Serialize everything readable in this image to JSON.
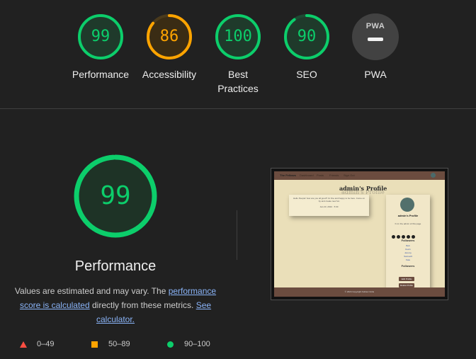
{
  "categories": [
    {
      "score": "99",
      "label": "Performance",
      "color": "#0cce6b"
    },
    {
      "score": "86",
      "label": "Accessibility",
      "color": "#ffa400"
    },
    {
      "score": "100",
      "label": "Best Practices",
      "color": "#0cce6b"
    },
    {
      "score": "90",
      "label": "SEO",
      "color": "#0cce6b"
    },
    {
      "score": "",
      "label": "PWA",
      "badge": "PWA"
    }
  ],
  "main": {
    "score": "99",
    "title": "Performance",
    "desc_prefix": "Values are estimated and may vary. The ",
    "desc_link1": "performance score is calculated",
    "desc_middle": " directly from these metrics. ",
    "desc_link2": "See calculator."
  },
  "legend": [
    {
      "icon": "red-triangle-icon",
      "range": "0–49",
      "color": "#ff4e42"
    },
    {
      "icon": "orange-square-icon",
      "range": "50–89",
      "color": "#ffa400"
    },
    {
      "icon": "green-circle-icon",
      "range": "90–100",
      "color": "#0cce6b"
    }
  ],
  "screenshot": {
    "brand": "The Fellows",
    "nav": [
      "Dashboard",
      "Posts",
      "Friends",
      "Sign Out"
    ],
    "title": "admin's Profile",
    "post_text": "Hello People! how are you all good? Im fine and happy to be here. Come on by and create new fun",
    "post_meta": "Jan 23, 2024 · 5:30",
    "profile_name": "admin's Profile",
    "profile_bio": "hi im the admin of this page",
    "followers_title": "Followers",
    "followers": [
      "Bob",
      "Kevin",
      "Jeremy",
      "Samuel3",
      "Kate"
    ],
    "following_title": "Followers",
    "btn1": "Edit Profile",
    "btn2": "Delete Profile",
    "footer": "© 2024 Copyright Fellow Circle"
  }
}
